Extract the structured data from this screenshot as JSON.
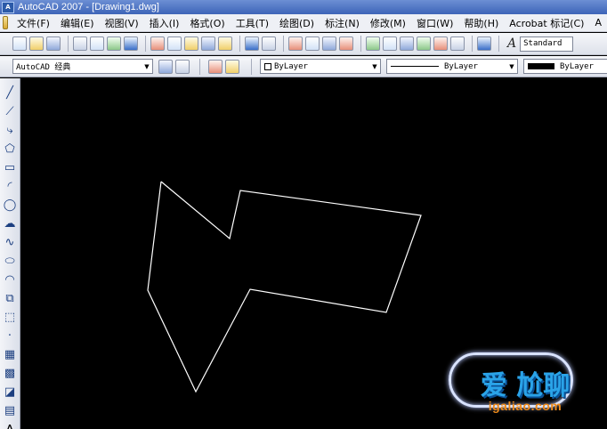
{
  "window": {
    "title": "AutoCAD 2007 - [Drawing1.dwg]",
    "app_icon_text": "A"
  },
  "menu": {
    "items": [
      "文件(F)",
      "编辑(E)",
      "视图(V)",
      "插入(I)",
      "格式(O)",
      "工具(T)",
      "绘图(D)",
      "标注(N)",
      "修改(M)",
      "窗口(W)",
      "帮助(H)",
      "Acrobat 标记(C)",
      "A"
    ]
  },
  "toolbar_standard": {
    "style_glyph": "A",
    "text_style": "Standard"
  },
  "toolbar_properties": {
    "workspace": "AutoCAD 经典",
    "color": "ByLayer",
    "linetype": "ByLayer",
    "lineweight": "ByLayer"
  },
  "draw_tools": [
    {
      "name": "line-tool",
      "glyph": "╱"
    },
    {
      "name": "construction-line-tool",
      "glyph": "⟋"
    },
    {
      "name": "polyline-tool",
      "glyph": "⤷"
    },
    {
      "name": "polygon-tool",
      "glyph": "⬠"
    },
    {
      "name": "rectangle-tool",
      "glyph": "▭"
    },
    {
      "name": "arc-tool",
      "glyph": "◜"
    },
    {
      "name": "circle-tool",
      "glyph": "◯"
    },
    {
      "name": "revision-cloud-tool",
      "glyph": "☁"
    },
    {
      "name": "spline-tool",
      "glyph": "∿"
    },
    {
      "name": "ellipse-tool",
      "glyph": "⬭"
    },
    {
      "name": "ellipse-arc-tool",
      "glyph": "◠"
    },
    {
      "name": "insert-block-tool",
      "glyph": "⧉"
    },
    {
      "name": "make-block-tool",
      "glyph": "⬚"
    },
    {
      "name": "point-tool",
      "glyph": "·"
    },
    {
      "name": "hatch-tool",
      "glyph": "▦"
    },
    {
      "name": "gradient-tool",
      "glyph": "▩"
    },
    {
      "name": "region-tool",
      "glyph": "◪"
    },
    {
      "name": "table-tool",
      "glyph": "▤"
    },
    {
      "name": "multiline-text-tool",
      "glyph": "A"
    }
  ],
  "watermark": {
    "brand": "爱 尬聊",
    "url": "igaliao.com"
  },
  "colors": {
    "canvas": "#000000",
    "drawing_stroke": "#ffffff",
    "titlebar": "#3d64b8"
  }
}
